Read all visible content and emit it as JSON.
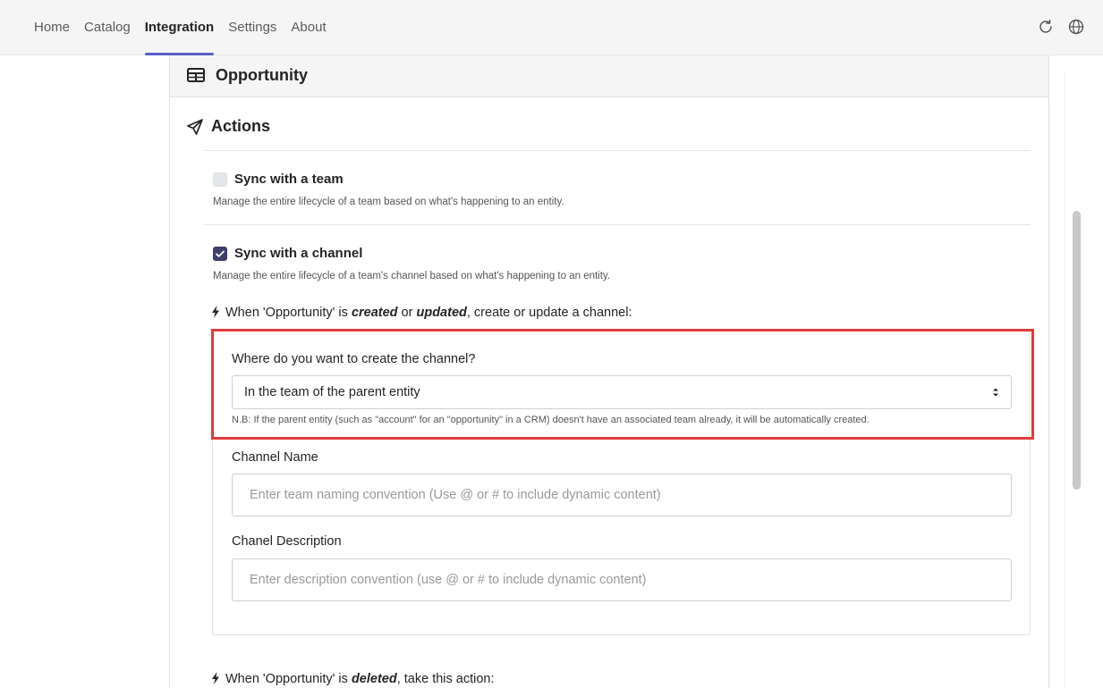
{
  "nav": {
    "tabs": [
      {
        "label": "Home"
      },
      {
        "label": "Catalog"
      },
      {
        "label": "Integration",
        "active": true
      },
      {
        "label": "Settings"
      },
      {
        "label": "About"
      }
    ],
    "icons": [
      "refresh-icon",
      "globe-icon"
    ]
  },
  "entity": {
    "title": "Opportunity",
    "icon": "table-icon"
  },
  "actions": {
    "title": "Actions",
    "icon": "paper-plane-icon"
  },
  "sync_team": {
    "checked": false,
    "label": "Sync with a team",
    "description": "Manage the entire lifecycle of a team based on what's happening to an entity."
  },
  "sync_channel": {
    "checked": true,
    "label": "Sync with a channel",
    "description": "Manage the entire lifecycle of a team's channel based on what's happening to an entity."
  },
  "trigger_update": {
    "prefix": "When 'Opportunity' is ",
    "word1": "created",
    "mid": " or ",
    "word2": "updated",
    "suffix": ", create or update a channel:"
  },
  "where_field": {
    "label": "Where do you want to create the channel?",
    "value": "In the team of the parent entity",
    "note": "N.B: If the parent entity (such as \"account\" for an \"opportunity\" in a CRM) doesn't have an associated team already, it will be automatically created."
  },
  "channel_name": {
    "label": "Channel Name",
    "placeholder": "Enter team naming convention (Use @ or # to include dynamic content)"
  },
  "channel_description": {
    "label": "Chanel Description",
    "placeholder": "Enter description convention (use @ or # to include dynamic content)"
  },
  "trigger_delete": {
    "prefix": "When 'Opportunity' is ",
    "word1": "deleted",
    "suffix": ", take this action:"
  },
  "colors": {
    "accent": "#5b5fc7",
    "checkbox_on": "#3e3e6e",
    "highlight": "#e03b3b"
  }
}
